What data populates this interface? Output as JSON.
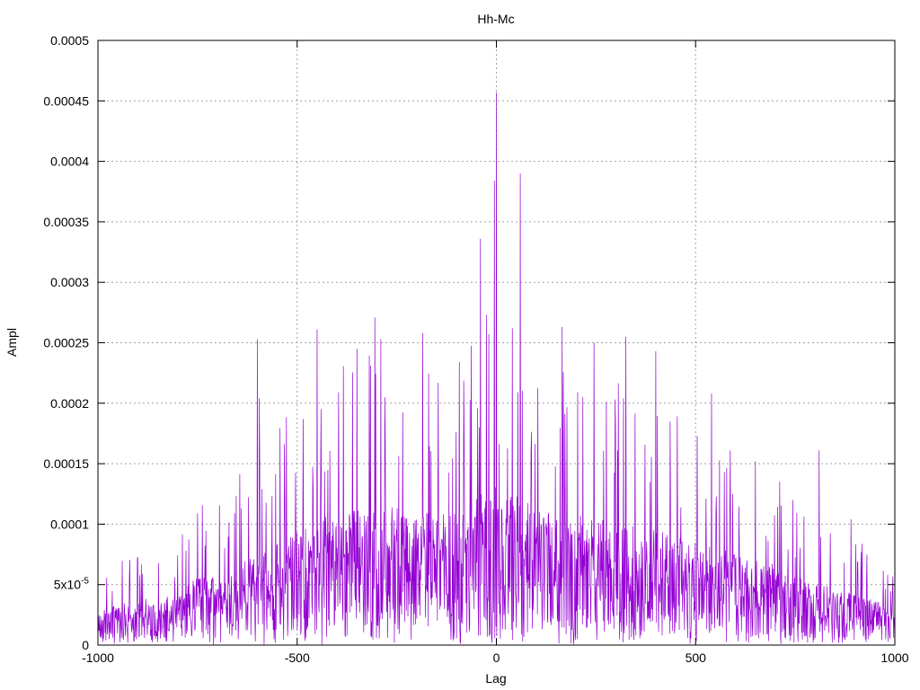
{
  "chart_data": {
    "type": "line",
    "title": "Hh-Mc",
    "xlabel": "Lag",
    "ylabel": "Ampl",
    "xlim": [
      -1000,
      1000
    ],
    "ylim": [
      0,
      0.0005
    ],
    "grid": true,
    "legend": "none",
    "series_color": "#9400d3",
    "x_ticks": [
      {
        "value": -1000,
        "label": "-1000"
      },
      {
        "value": -500,
        "label": "-500"
      },
      {
        "value": 0,
        "label": "0"
      },
      {
        "value": 500,
        "label": "500"
      },
      {
        "value": 1000,
        "label": "1000"
      }
    ],
    "y_ticks": [
      {
        "value": 0,
        "label": "0"
      },
      {
        "value": 5e-05,
        "label": "5x10",
        "sup": "-5"
      },
      {
        "value": 0.0001,
        "label": "0.0001"
      },
      {
        "value": 0.00015,
        "label": "0.00015"
      },
      {
        "value": 0.0002,
        "label": "0.0002"
      },
      {
        "value": 0.00025,
        "label": "0.00025"
      },
      {
        "value": 0.0003,
        "label": "0.0003"
      },
      {
        "value": 0.00035,
        "label": "0.00035"
      },
      {
        "value": 0.0004,
        "label": "0.0004"
      },
      {
        "value": 0.00045,
        "label": "0.00045"
      },
      {
        "value": 0.0005,
        "label": "0.0005"
      }
    ],
    "envelope": {
      "x": [
        -1000,
        -900,
        -800,
        -750,
        -700,
        -650,
        -600,
        -550,
        -500,
        -450,
        -400,
        -350,
        -300,
        -250,
        -200,
        -150,
        -100,
        -50,
        0,
        50,
        100,
        150,
        200,
        250,
        300,
        350,
        400,
        450,
        500,
        550,
        600,
        650,
        700,
        750,
        800,
        850,
        900,
        950,
        1000
      ],
      "y": [
        3e-05,
        4e-05,
        4.5e-05,
        6e-05,
        6e-05,
        7e-05,
        8e-05,
        9e-05,
        0.0001,
        0.00011,
        0.000115,
        0.00012,
        0.000125,
        0.00012,
        0.000115,
        0.000115,
        0.00012,
        0.00013,
        0.00014,
        0.00013,
        0.00012,
        0.000115,
        0.000115,
        0.00011,
        0.00011,
        0.000105,
        0.0001,
        9.5e-05,
        9e-05,
        8.5e-05,
        8e-05,
        7.5e-05,
        7e-05,
        6e-05,
        5.5e-05,
        5e-05,
        4.5e-05,
        4e-05,
        3e-05
      ]
    },
    "peaks": [
      {
        "x": 0,
        "y": 0.000457
      },
      {
        "x": -5,
        "y": 0.000384
      },
      {
        "x": 60,
        "y": 0.00039
      },
      {
        "x": -40,
        "y": 0.000336
      },
      {
        "x": -25,
        "y": 0.000273
      },
      {
        "x": 40,
        "y": 0.000262
      },
      {
        "x": 165,
        "y": 0.000263
      },
      {
        "x": 245,
        "y": 0.00025
      },
      {
        "x": 325,
        "y": 0.000255
      },
      {
        "x": 400,
        "y": 0.000243
      },
      {
        "x": 540,
        "y": 0.000208
      },
      {
        "x": -305,
        "y": 0.000271
      },
      {
        "x": -290,
        "y": 0.000253
      },
      {
        "x": -450,
        "y": 0.000261
      },
      {
        "x": -600,
        "y": 0.000253
      },
      {
        "x": -595,
        "y": 0.000204
      },
      {
        "x": -185,
        "y": 0.000258
      },
      {
        "x": -350,
        "y": 0.000245
      },
      {
        "x": 810,
        "y": 0.000161
      },
      {
        "x": 650,
        "y": 0.000152
      },
      {
        "x": 890,
        "y": 0.000104
      },
      {
        "x": -750,
        "y": 0.000109
      },
      {
        "x": -640,
        "y": 0.000113
      }
    ]
  }
}
